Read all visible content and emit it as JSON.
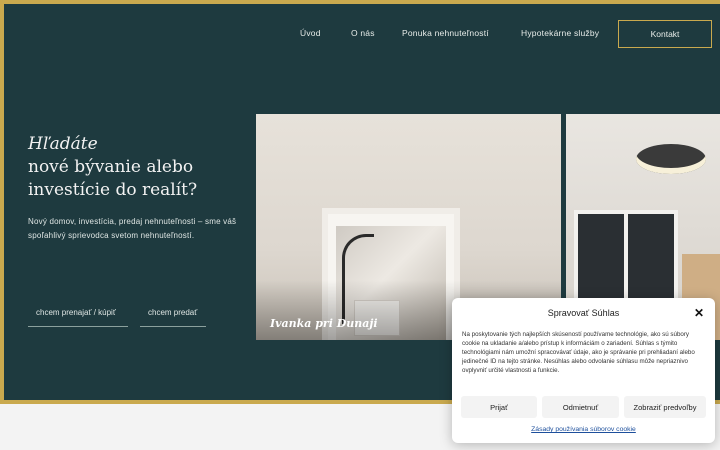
{
  "nav": {
    "items": [
      {
        "label": "Úvod"
      },
      {
        "label": "O nás"
      },
      {
        "label": "Ponuka nehnuteľností"
      },
      {
        "label": "Hypotekárne služby"
      }
    ],
    "contact_label": "Kontakt"
  },
  "hero": {
    "eyebrow": "Hľadáte",
    "headline": "nové bývanie alebo investície do realít?",
    "lead": "Nový domov, investícia, predaj nehnuteľnosti – sme váš spoľahlivý sprievodca svetom nehnuteľností.",
    "cta_rent_buy": "chcem prenajať / kúpiť",
    "cta_sell": "chcem predať"
  },
  "gallery": {
    "caption": "Ivanka pri Dunaji"
  },
  "cookie": {
    "title": "Spravovať Súhlas",
    "text": "Na poskytovanie tých najlepších skúseností používame technológie, ako sú súbory cookie na ukladanie a/alebo prístup k informáciám o zariadení. Súhlas s týmito technológiami nám umožní spracovávať údaje, ako je správanie pri prehliadaní alebo jedinečné ID na tejto stránke. Nesúhlas alebo odvolanie súhlasu môže nepriaznivo ovplyvniť určité vlastnosti a funkcie.",
    "accept": "Prijať",
    "deny": "Odmietnuť",
    "preferences": "Zobraziť predvoľby",
    "policy_link": "Zásady používania súborov cookie"
  },
  "colors": {
    "hero_bg": "#1e3a3f",
    "accent_gold": "#c9a94e",
    "link_blue": "#1d4f9c"
  }
}
